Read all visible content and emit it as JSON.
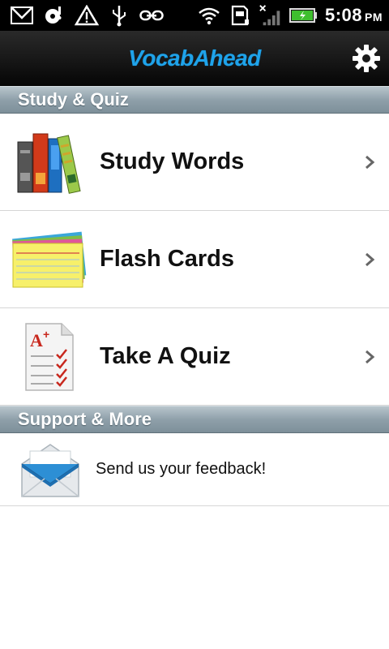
{
  "status_bar": {
    "icons": [
      "gmail-icon",
      "upload-icon",
      "warning-icon",
      "usb-icon",
      "link-icon",
      "wifi-icon",
      "sd-card-icon",
      "signal-icon",
      "battery-icon"
    ],
    "time": "5:08",
    "ampm": "PM"
  },
  "header": {
    "logo_text": "VocabAhead",
    "settings_icon": "gear-icon"
  },
  "sections": {
    "study": {
      "title": "Study & Quiz",
      "items": [
        {
          "label": "Study Words",
          "icon": "books-icon"
        },
        {
          "label": "Flash Cards",
          "icon": "flashcards-icon"
        },
        {
          "label": "Take A Quiz",
          "icon": "quiz-paper-icon"
        }
      ]
    },
    "support": {
      "title": "Support & More",
      "items": [
        {
          "label": "Send us your feedback!",
          "icon": "envelope-icon"
        }
      ]
    }
  },
  "colors": {
    "accent": "#1fa3ea",
    "section_header": "#8fa0aa",
    "title_bar": "#1a1a1a"
  }
}
